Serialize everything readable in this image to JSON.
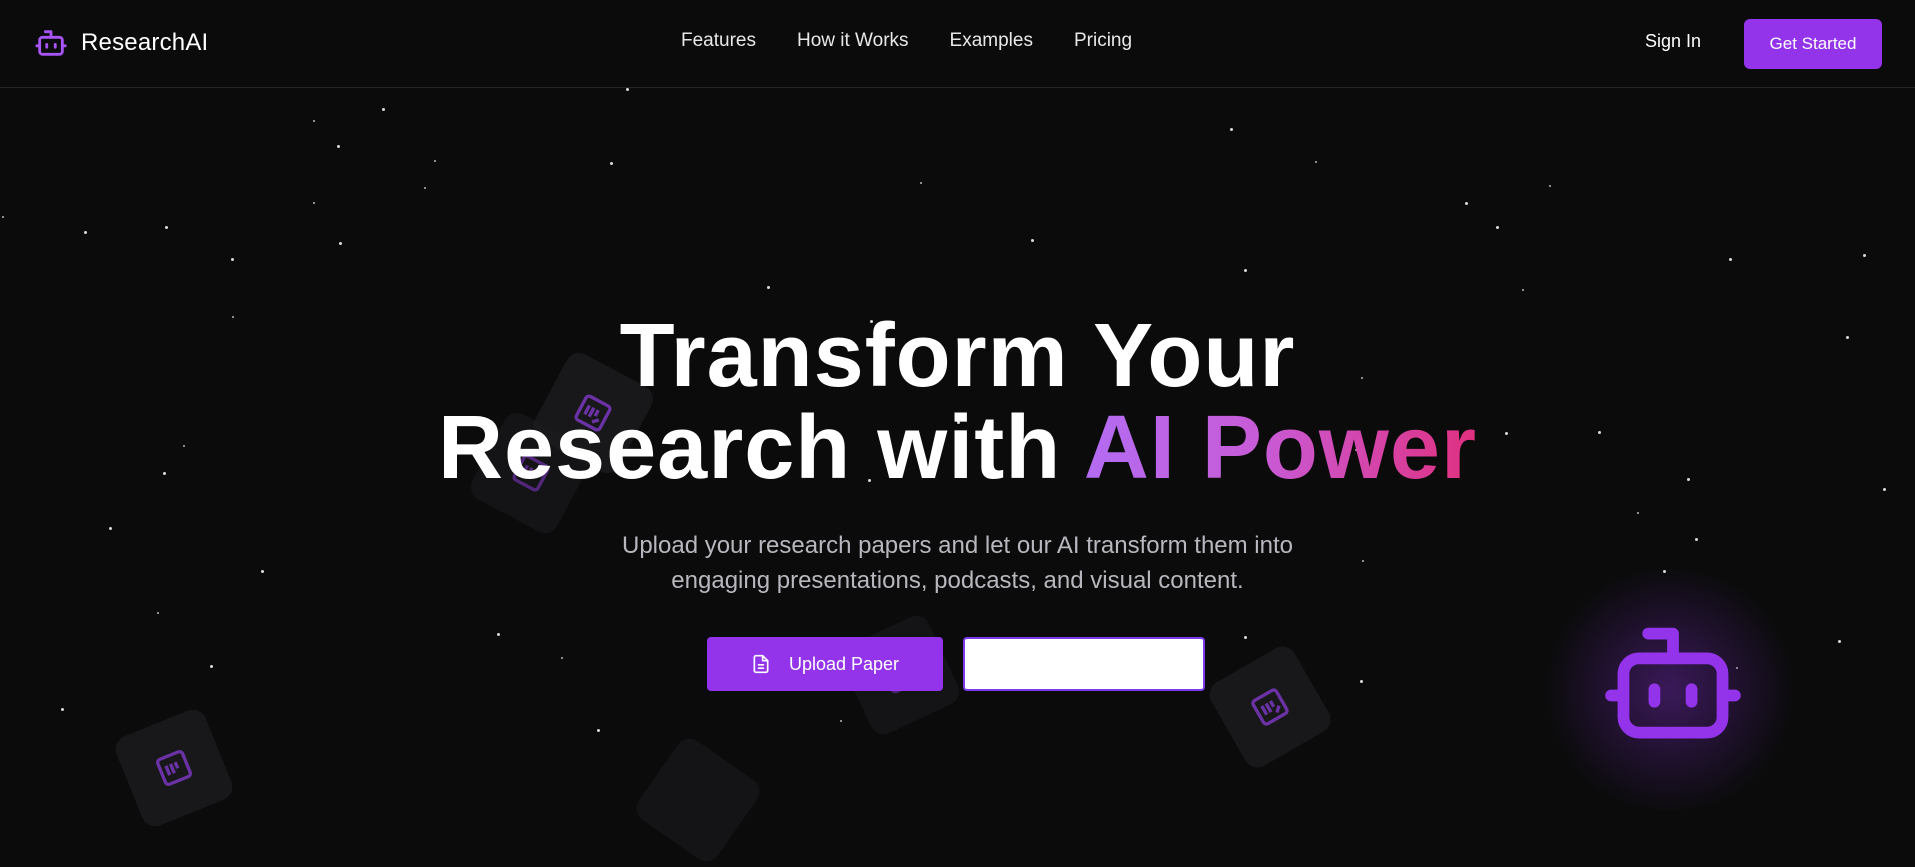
{
  "nav": {
    "brand": "ResearchAI",
    "links": [
      "Features",
      "How it Works",
      "Examples",
      "Pricing"
    ],
    "sign_in": "Sign In",
    "get_started": "Get Started"
  },
  "hero": {
    "title_line1": "Transform Your",
    "title_line2_plain": "Research with ",
    "title_line2_highlight": "AI Power",
    "subtitle_line1": "Upload your research papers and let our AI transform them into",
    "subtitle_line2": "engaging presentations, podcasts, and visual content.",
    "upload_button": "Upload Paper"
  },
  "icons": {
    "brand": "robot-icon",
    "upload": "file-text-icon",
    "card": "document-icon",
    "mascot": "robot-icon"
  },
  "colors": {
    "accent": "#9333ea",
    "background": "#0b0b0c",
    "gradient_start": "#b36cf2",
    "gradient_end": "#e0307f"
  }
}
